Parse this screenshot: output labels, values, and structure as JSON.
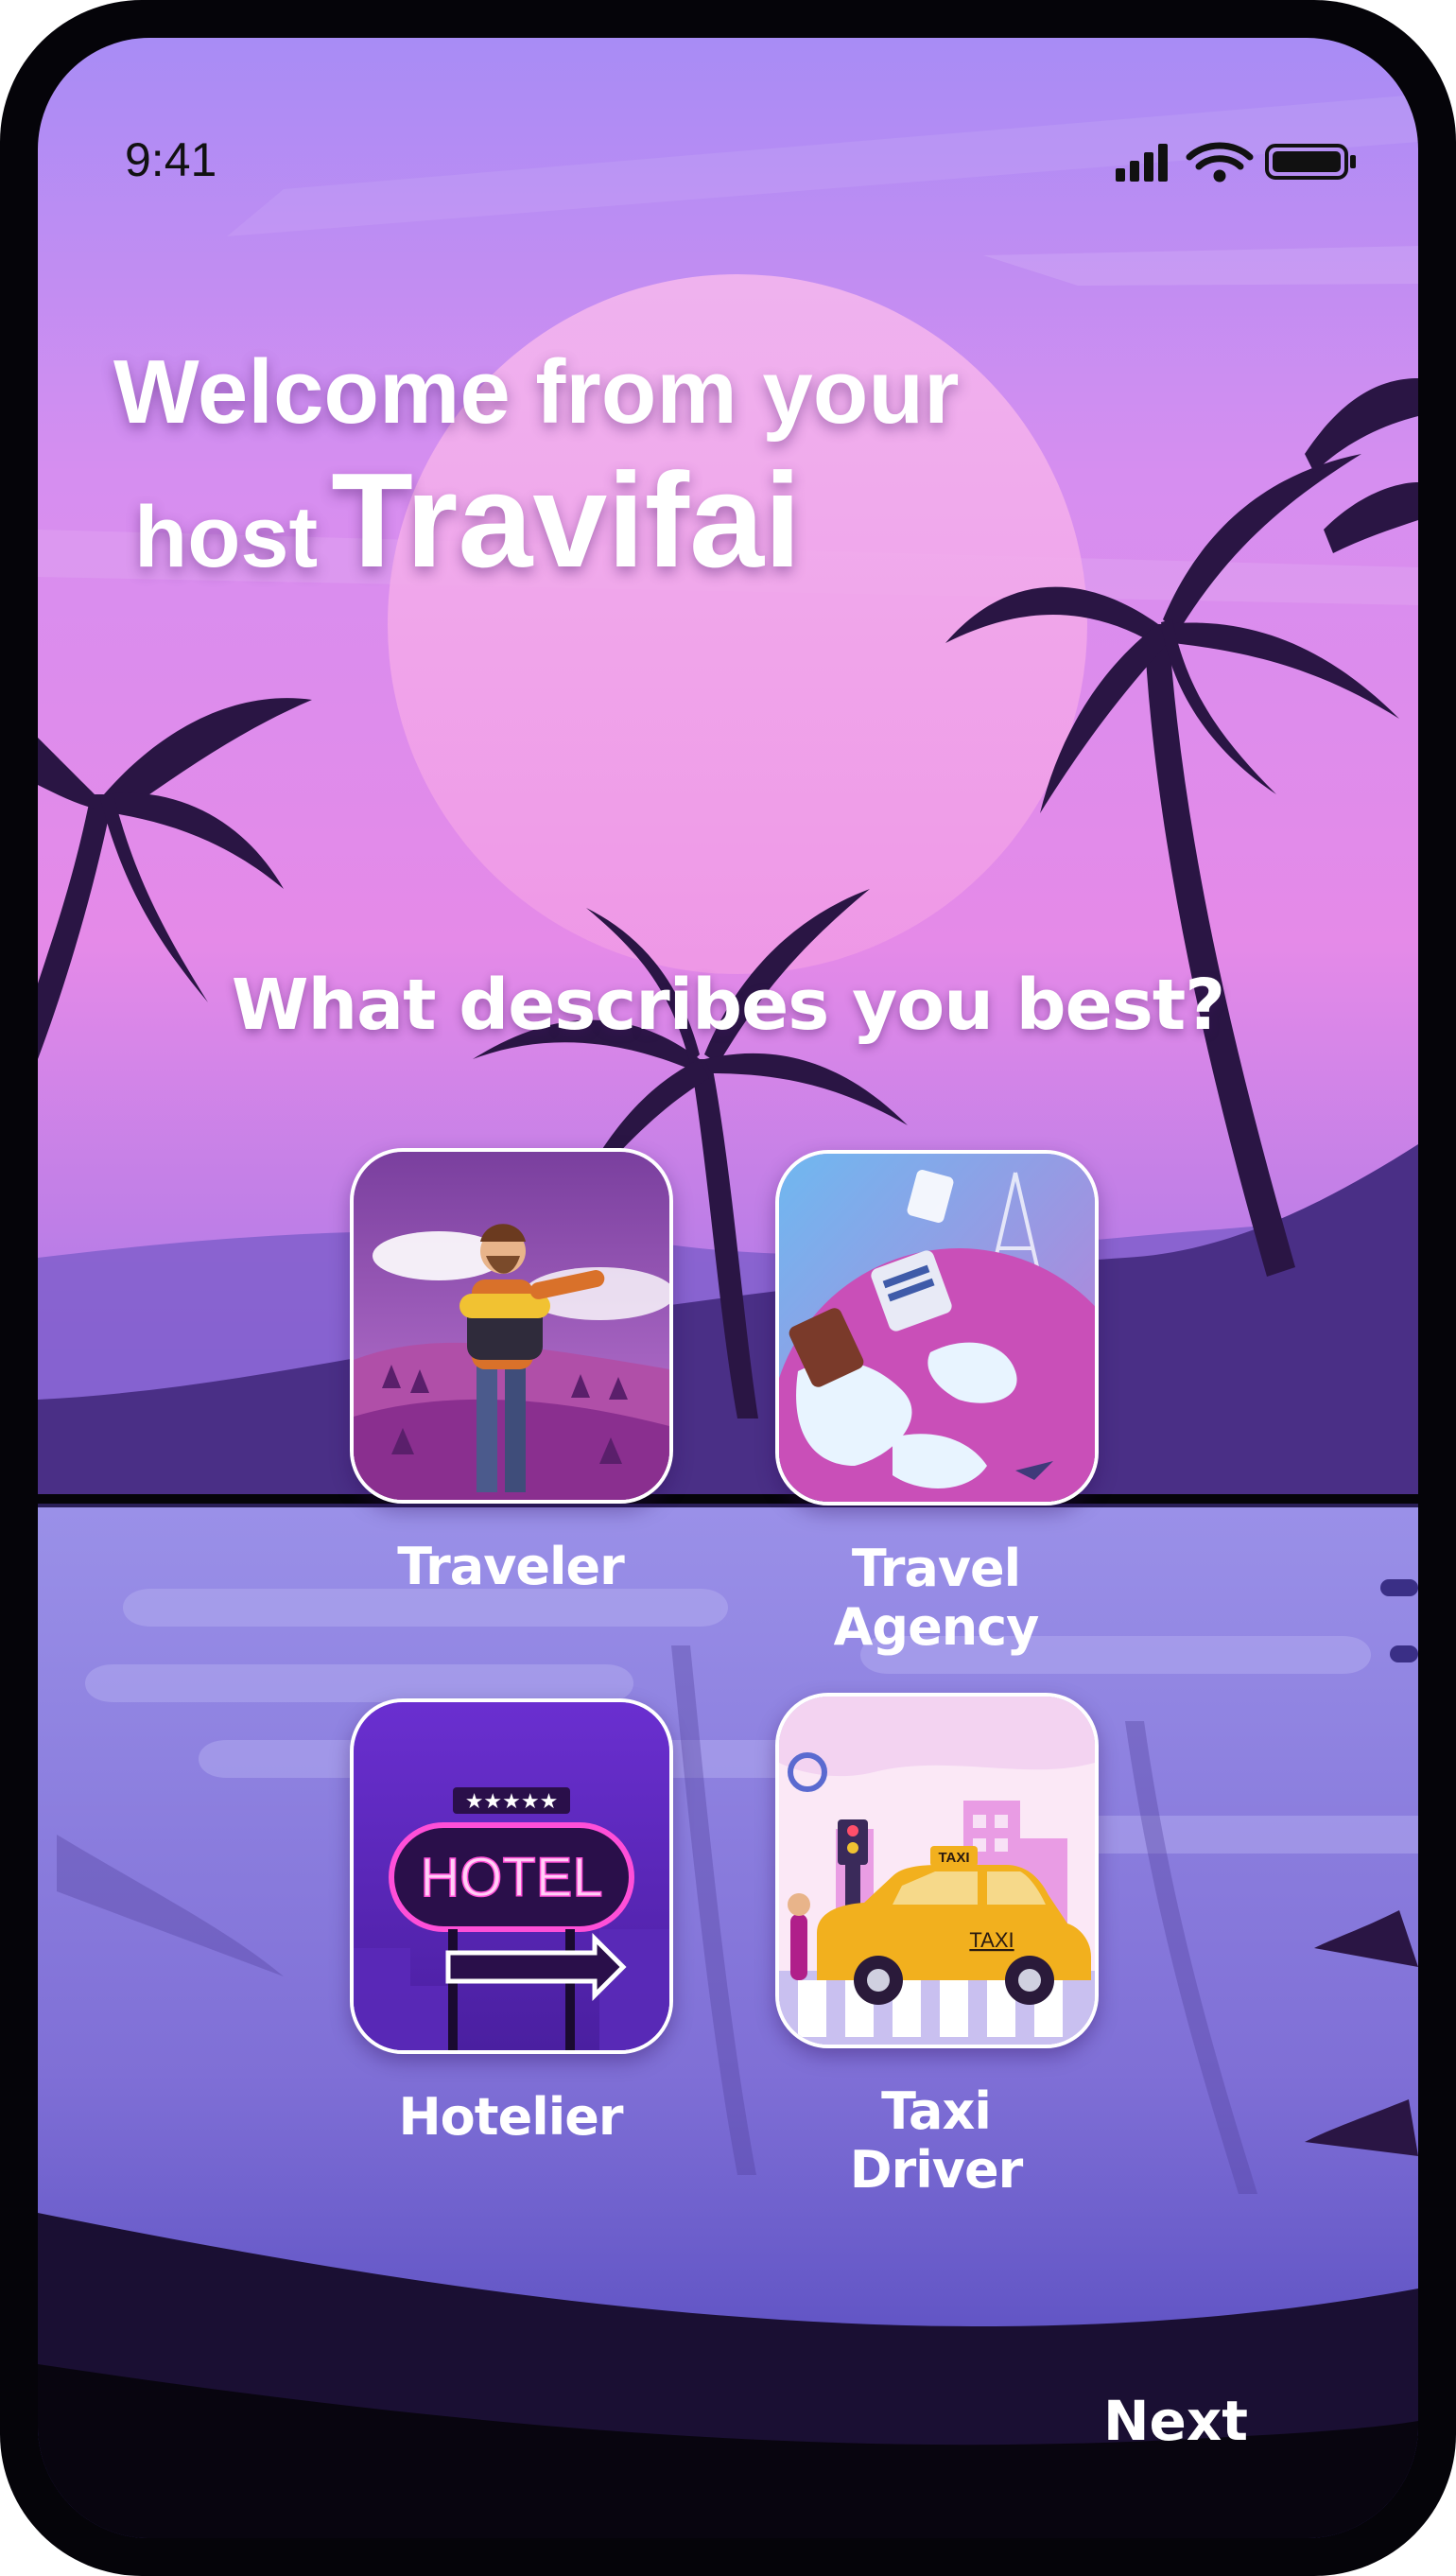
{
  "status_bar": {
    "time": "9:41",
    "icons": [
      "cellular-signal-icon",
      "wifi-icon",
      "battery-icon"
    ]
  },
  "welcome": {
    "line1": "Welcome from your",
    "host": "host",
    "brand": "Travifai"
  },
  "question": "What describes you best?",
  "options": [
    {
      "label": "Traveler",
      "icon": "traveler-illustration"
    },
    {
      "label": "Travel Agency",
      "icon": "travel-agency-illustration"
    },
    {
      "label": "Hotelier",
      "icon": "hotel-sign-illustration",
      "sign_text": "HOTEL"
    },
    {
      "label": "Taxi Driver",
      "icon": "taxi-illustration",
      "sign_text": "TAXI",
      "roof_text": "TAXI"
    }
  ],
  "next_label": "Next",
  "colors": {
    "sky_top": "#a98bf4",
    "sky_pink": "#e58ae8",
    "water": "#8a80e2",
    "silhouette": "#2a1544",
    "text": "#ffffff"
  }
}
